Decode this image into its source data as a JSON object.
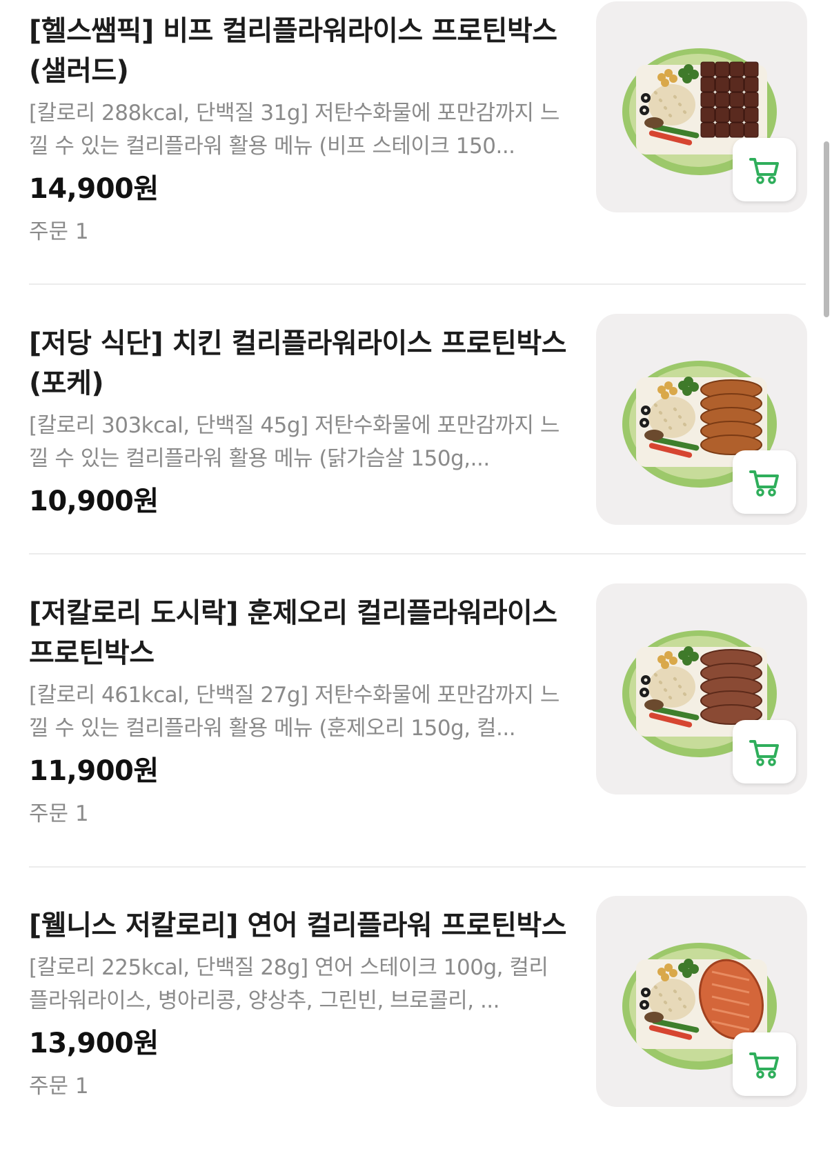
{
  "accent_color": "#2fae5b",
  "products": [
    {
      "title": "[헬스쌤픽] 비프 컬리플라워라이스 프로틴박스 (샐러드)",
      "description": "[칼로리 288kcal, 단백질 31g] 저탄수화물에 포만감까지 느낄 수 있는 컬리플라워 활용 메뉴 (비프 스테이크 150...",
      "price": "14,900원",
      "orders": "주문 1",
      "protein": "beef",
      "cart_icon": "cart-icon"
    },
    {
      "title": "[저당 식단] 치킨 컬리플라워라이스 프로틴박스 (포케)",
      "description": "[칼로리 303kcal, 단백질 45g] 저탄수화물에 포만감까지 느낄 수 있는 컬리플라워 활용 메뉴 (닭가슴살 150g,...",
      "price": "10,900원",
      "orders": "",
      "protein": "chicken",
      "cart_icon": "cart-icon"
    },
    {
      "title": "[저칼로리 도시락] 훈제오리 컬리플라워라이스 프로틴박스",
      "description": "[칼로리 461kcal, 단백질 27g] 저탄수화물에 포만감까지 느낄 수 있는 컬리플라워 활용 메뉴 (훈제오리 150g, 컬...",
      "price": "11,900원",
      "orders": "주문 1",
      "protein": "duck",
      "cart_icon": "cart-icon"
    },
    {
      "title": "[웰니스 저칼로리] 연어 컬리플라워 프로틴박스",
      "description": "[칼로리 225kcal, 단백질 28g] 연어 스테이크 100g, 컬리플라워라이스, 병아리콩, 양상추, 그린빈, 브로콜리, ...",
      "price": "13,900원",
      "orders": "주문 1",
      "protein": "salmon",
      "cart_icon": "cart-icon"
    }
  ]
}
